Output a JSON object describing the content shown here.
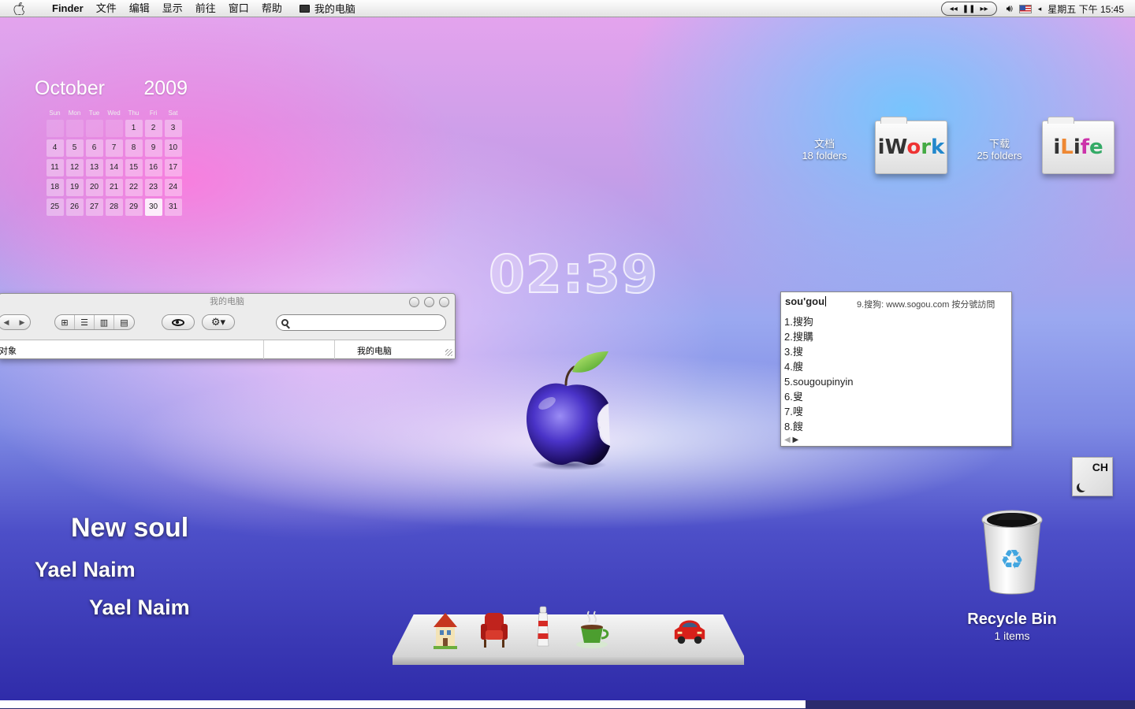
{
  "menubar": {
    "app_name": "Finder",
    "menus": [
      "文件",
      "编辑",
      "显示",
      "前往",
      "窗口",
      "帮助"
    ],
    "current_doc": "我的电脑",
    "media_controls": [
      "◂◂",
      "❚❚",
      "▸▸"
    ],
    "datetime": "星期五 下午 15:45"
  },
  "calendar": {
    "month": "October",
    "year": "2009",
    "weekdays": [
      "Sun",
      "Mon",
      "Tue",
      "Wed",
      "Thu",
      "Fri",
      "Sat"
    ],
    "days": [
      "",
      "",
      "",
      "",
      "1",
      "2",
      "3",
      "4",
      "5",
      "6",
      "7",
      "8",
      "9",
      "10",
      "11",
      "12",
      "13",
      "14",
      "15",
      "16",
      "17",
      "18",
      "19",
      "20",
      "21",
      "22",
      "23",
      "24",
      "25",
      "26",
      "27",
      "28",
      "29",
      "30",
      "31"
    ],
    "today": "30"
  },
  "clock": {
    "time": "02:39"
  },
  "finder": {
    "title": "我的电脑",
    "search_placeholder": "",
    "status_left": "对象",
    "status_right": "我的电脑"
  },
  "stacks": [
    {
      "name": "文档",
      "count": "18 folders",
      "logo": "iWork"
    },
    {
      "name": "下载",
      "count": "25 folders",
      "logo": "iLife"
    }
  ],
  "ime": {
    "pinyin": "sou'gou",
    "hint": "9.搜狗: www.sogou.com 按分號訪問",
    "candidates": [
      "1.搜狗",
      "2.搜購",
      "3.搜",
      "4.艘",
      "5.sougoupinyin",
      "6.叟",
      "7.嗖",
      "8.餿"
    ]
  },
  "input_indicator": {
    "label": "CH"
  },
  "now_playing": {
    "title": "New soul",
    "artist": "Yael Naim",
    "album": "Yael Naim"
  },
  "dock": {
    "items": [
      "house-icon",
      "armchair-icon",
      "lighthouse-icon",
      "coffee-cup-icon",
      "car-icon"
    ]
  },
  "recycle_bin": {
    "label": "Recycle Bin",
    "count": "1 items"
  },
  "playback_progress": 0.71
}
